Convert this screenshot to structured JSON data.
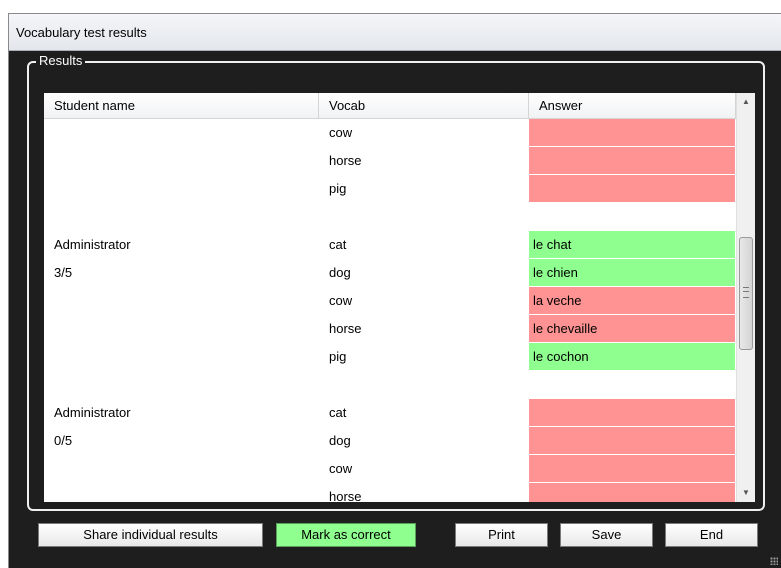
{
  "window": {
    "title": "Vocabulary test results"
  },
  "results_group": {
    "label": "Results"
  },
  "grid": {
    "columns": [
      "Student name",
      "Vocab",
      "Answer"
    ],
    "rows": [
      {
        "name": "",
        "vocab": "cow",
        "answer": "",
        "status": "wrong"
      },
      {
        "name": "",
        "vocab": "horse",
        "answer": "",
        "status": "wrong"
      },
      {
        "name": "",
        "vocab": "pig",
        "answer": "",
        "status": "wrong"
      },
      {
        "name": "",
        "vocab": "",
        "answer": "",
        "status": "none"
      },
      {
        "name": "Administrator",
        "vocab": "cat",
        "answer": "le chat",
        "status": "right"
      },
      {
        "name": "3/5",
        "vocab": "dog",
        "answer": "le chien",
        "status": "right"
      },
      {
        "name": "",
        "vocab": "cow",
        "answer": "la veche",
        "status": "wrong"
      },
      {
        "name": "",
        "vocab": "horse",
        "answer": "le chevaille",
        "status": "wrong"
      },
      {
        "name": "",
        "vocab": "pig",
        "answer": "le cochon",
        "status": "right"
      },
      {
        "name": "",
        "vocab": "",
        "answer": "",
        "status": "none"
      },
      {
        "name": "Administrator",
        "vocab": "cat",
        "answer": "",
        "status": "wrong"
      },
      {
        "name": "0/5",
        "vocab": "dog",
        "answer": "",
        "status": "wrong"
      },
      {
        "name": "",
        "vocab": "cow",
        "answer": "",
        "status": "wrong"
      },
      {
        "name": "",
        "vocab": "horse",
        "answer": "",
        "status": "wrong"
      }
    ]
  },
  "buttons": {
    "share": "Share individual results",
    "mark_correct": "Mark as correct",
    "print": "Print",
    "save": "Save",
    "end": "End"
  },
  "colors": {
    "wrong": "#ff9292",
    "right": "#8fff8f",
    "background": "#1e1e1e"
  },
  "scrollbar": {
    "up": "▲",
    "down": "▼"
  }
}
